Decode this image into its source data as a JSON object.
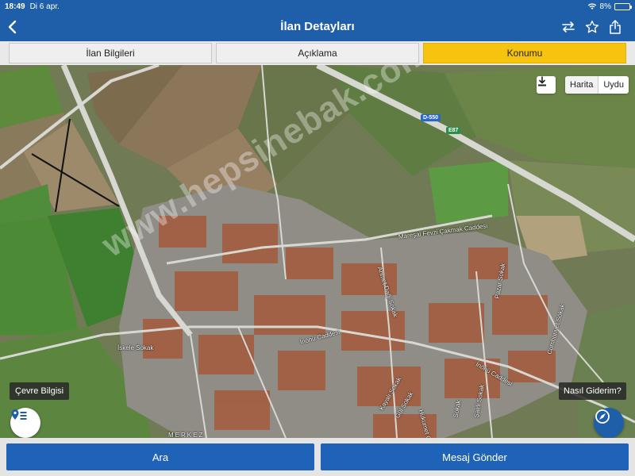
{
  "status": {
    "time": "18:49",
    "date": "Di 6 apr.",
    "battery": "8%",
    "battery_level": 0.08
  },
  "nav": {
    "title": "İlan Detayları",
    "back_icon": "chevron-left-icon",
    "actions": [
      "compare-arrows-icon",
      "star-icon",
      "share-icon"
    ]
  },
  "tabs": [
    {
      "label": "İlan Bilgileri",
      "active": false
    },
    {
      "label": "Açıklama",
      "active": false
    },
    {
      "label": "Konumu",
      "active": true
    }
  ],
  "map": {
    "type_options": [
      "Harita",
      "Uydu"
    ],
    "selected_type": "Harita",
    "watermark": "www.hepsinebak.com",
    "env_info_label": "Çevre Bilgisi",
    "how_to_label": "Nasıl Giderim?",
    "shields": [
      "D-550",
      "E87"
    ],
    "streets": [
      "Mareşal Fevzi Çakmak Caddesi",
      "İnönü Caddesi",
      "İnönü Caddesi",
      "İskele Sokak",
      "Ahmet Daği Sokak",
      "Pazar Sokak",
      "Cumhuriyet Sokak",
      "Kayalı Sokak",
      "Şairli Sokak",
      "Hükümet Caddesi",
      "Gül Sokak",
      "Sokak",
      "MERKEZ"
    ]
  },
  "colors": {
    "primary": "#1f5ea8",
    "tab_active": "#f6c40f"
  },
  "actions": {
    "call_label": "Ara",
    "message_label": "Mesaj Gönder"
  }
}
